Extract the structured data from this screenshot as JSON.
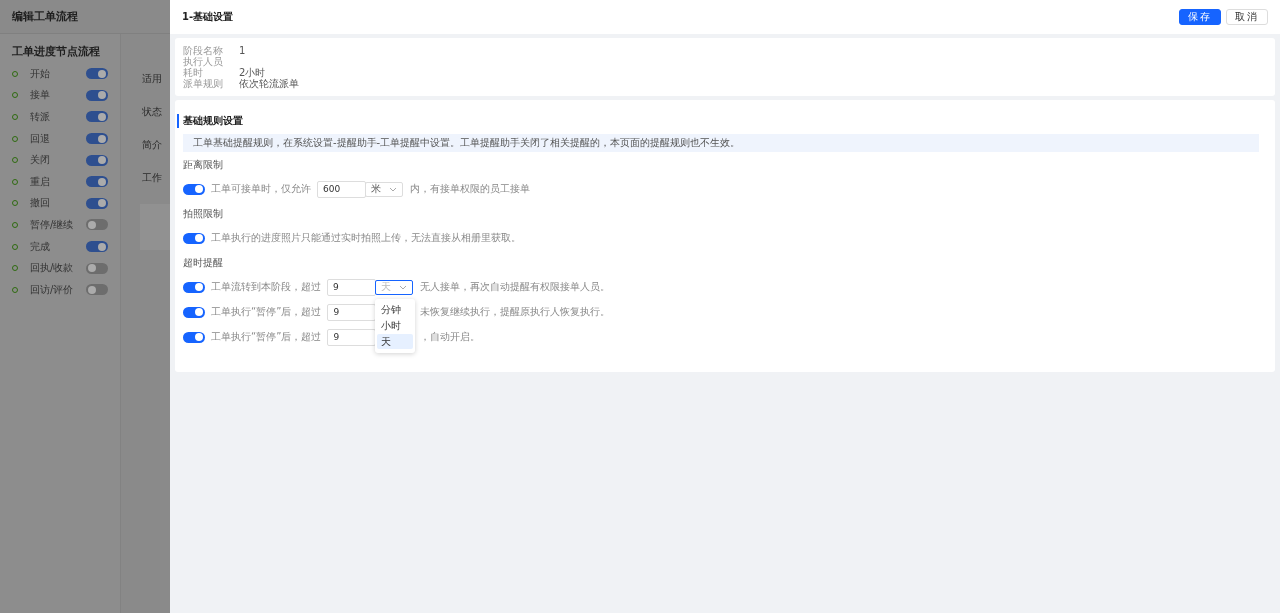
{
  "page": {
    "title": "编辑工单流程",
    "section_title": "工单进度节点流程",
    "steps": [
      {
        "label": "开始",
        "on": true
      },
      {
        "label": "接单",
        "on": true
      },
      {
        "label": "转派",
        "on": true
      },
      {
        "label": "回退",
        "on": true
      },
      {
        "label": "关闭",
        "on": true
      },
      {
        "label": "重启",
        "on": true
      },
      {
        "label": "撤回",
        "on": true
      },
      {
        "label": "暂停/继续",
        "on": false
      },
      {
        "label": "完成",
        "on": true
      },
      {
        "label": "回执/收款",
        "on": false
      },
      {
        "label": "回访/评价",
        "on": false
      }
    ],
    "form_labels": [
      "适用",
      "状态",
      "简介",
      "工作"
    ]
  },
  "drawer": {
    "title": "1-基础设置",
    "buttons": [
      {
        "label": "保存",
        "kind": "primary"
      },
      {
        "label": "取消",
        "kind": "default"
      }
    ],
    "info": [
      {
        "label": "阶段名称",
        "value": "1"
      },
      {
        "label": "执行人员"
      },
      {
        "label": "耗时",
        "value": "2小时"
      },
      {
        "label": "派单规则",
        "value": "依次轮流派单"
      }
    ],
    "rules": {
      "title": "基础规则设置",
      "notice": "工单基础提醒规则，在系统设置-提醒助手-工单提醒中设置。工单提醒助手关闭了相关提醒的，本页面的提醒规则也不生效。",
      "groups": [
        {
          "title": "距离限制",
          "rows": [
            {
              "kind": "input",
              "on": true,
              "before": "工单可接单时，仅允许",
              "value": "600",
              "unit": "米",
              "unit_focused": false,
              "after": "内，有接单权限的员工接单"
            }
          ]
        },
        {
          "title": "拍照限制",
          "rows": [
            {
              "kind": "text",
              "on": true,
              "before": "工单执行的进度照片只能通过实时拍照上传，无法直接从相册里获取。"
            }
          ]
        },
        {
          "title": "超时提醒",
          "rows": [
            {
              "kind": "input",
              "on": true,
              "before": "工单流转到本阶段，超过",
              "value": "9",
              "unit": "天",
              "unit_focused": true,
              "after": "无人接单，再次自动提醒有权限接单人员。",
              "dropdown": [
                {
                  "label": "分钟",
                  "selected": false
                },
                {
                  "label": "小时",
                  "selected": false
                },
                {
                  "label": "天",
                  "selected": true
                }
              ]
            },
            {
              "kind": "input",
              "on": true,
              "before": "工单执行“暂停”后，超过",
              "value": "9",
              "after": "未恢复继续执行，提醒原执行人恢复执行。"
            },
            {
              "kind": "input",
              "on": true,
              "before": "工单执行“暂停”后，超过",
              "value": "9",
              "after": "，自动开启。"
            }
          ]
        }
      ]
    }
  }
}
